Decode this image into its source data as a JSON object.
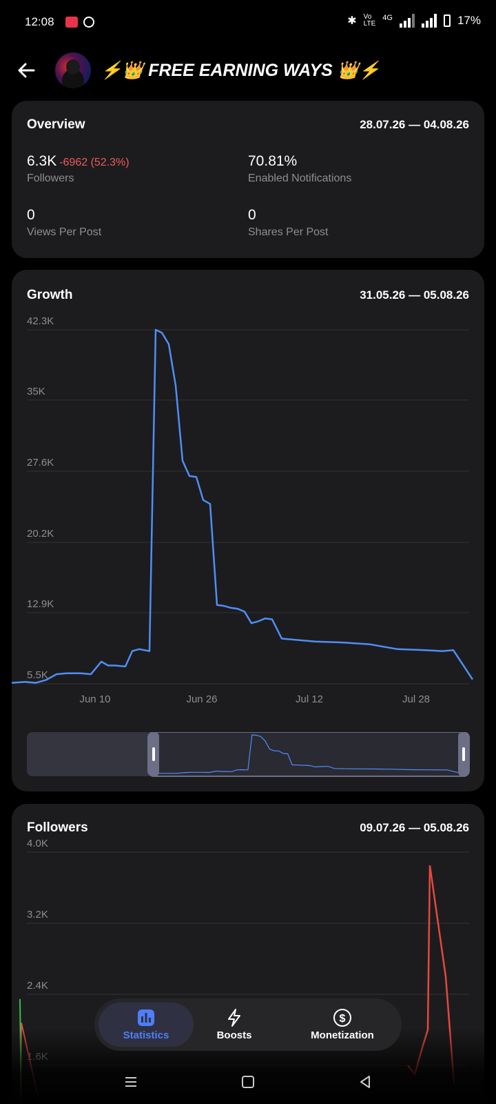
{
  "status_bar": {
    "time": "12:08",
    "network": "4G",
    "battery": "17%"
  },
  "header": {
    "title": "⚡👑 FREE EARNING WAYS 👑⚡",
    "back_icon": "arrow-left-icon"
  },
  "overview": {
    "title": "Overview",
    "range": "28.07.26 — 04.08.26",
    "followers": {
      "value": "6.3K",
      "delta": "-6962 (52.3%)",
      "label": "Followers"
    },
    "notifications": {
      "value": "70.81%",
      "label": "Enabled Notifications"
    },
    "views": {
      "value": "0",
      "label": "Views Per Post"
    },
    "shares": {
      "value": "0",
      "label": "Shares Per Post"
    }
  },
  "growth": {
    "title": "Growth",
    "range": "31.05.26 — 05.08.26",
    "y_ticks": [
      "42.3K",
      "35K",
      "27.6K",
      "20.2K",
      "12.9K",
      "5.5K"
    ],
    "x_ticks": [
      "Jun 10",
      "Jun 26",
      "Jul 12",
      "Jul 28"
    ]
  },
  "followers_chart": {
    "title": "Followers",
    "range": "09.07.26 — 05.08.26",
    "y_ticks": [
      "4.0K",
      "3.2K",
      "2.4K",
      "1.6K"
    ]
  },
  "colors": {
    "line_blue": "#4f8ff7",
    "red": "#e5493f",
    "green": "#31c24a",
    "card": "#1c1c1e"
  },
  "tabs": [
    {
      "label": "Statistics",
      "icon": "bar-chart-icon",
      "active": true
    },
    {
      "label": "Boosts",
      "icon": "lightning-icon",
      "active": false
    },
    {
      "label": "Monetization",
      "icon": "dollar-icon",
      "active": false
    }
  ],
  "chart_data": [
    {
      "type": "line",
      "title": "Growth",
      "x": [
        "31.05",
        "02.06",
        "04.06",
        "06.06",
        "08.06",
        "10.06",
        "12.06",
        "14.06",
        "15.06",
        "16.06",
        "18.06",
        "20.06",
        "21.06",
        "22.06",
        "24.06",
        "24.06",
        "25.06",
        "26.06",
        "27.06",
        "28.06",
        "29.06",
        "30.06",
        "01.07",
        "02.07",
        "03.07",
        "04.07",
        "05.07",
        "06.07",
        "07.07",
        "08.07",
        "09.07",
        "10.07",
        "11.07",
        "12.07",
        "16.07",
        "20.07",
        "24.07",
        "28.07",
        "01.08",
        "03.08",
        "04.08",
        "05.08"
      ],
      "series": [
        {
          "values": [
            5600,
            5700,
            5600,
            5900,
            6500,
            6600,
            6600,
            6500,
            7800,
            7400,
            7400,
            7300,
            8900,
            9100,
            8900,
            42300,
            42000,
            40800,
            36500,
            28700,
            27100,
            27000,
            24600,
            24200,
            13700,
            13600,
            13400,
            13300,
            13000,
            11800,
            12000,
            12300,
            12200,
            10200,
            9900,
            9800,
            9600,
            9100,
            9000,
            8900,
            3000,
            2100
          ]
        }
      ],
      "yticks": [
        5500,
        12900,
        20200,
        27600,
        35000,
        42300
      ],
      "xticks": [
        "Jun 10",
        "Jun 26",
        "Jul 12",
        "Jul 28"
      ],
      "ylim": [
        5000,
        43500
      ],
      "grid": true
    },
    {
      "type": "line",
      "title": "Followers",
      "series": [
        {
          "values": [
            1600,
            1500,
            1800,
            2000,
            3850,
            2600,
            1400
          ]
        },
        {
          "values": [
            1500,
            2700,
            1600,
            1300
          ]
        }
      ],
      "yticks": [
        1600,
        2400,
        3200,
        4000
      ],
      "ylim": [
        1200,
        4200
      ],
      "grid": true
    }
  ]
}
